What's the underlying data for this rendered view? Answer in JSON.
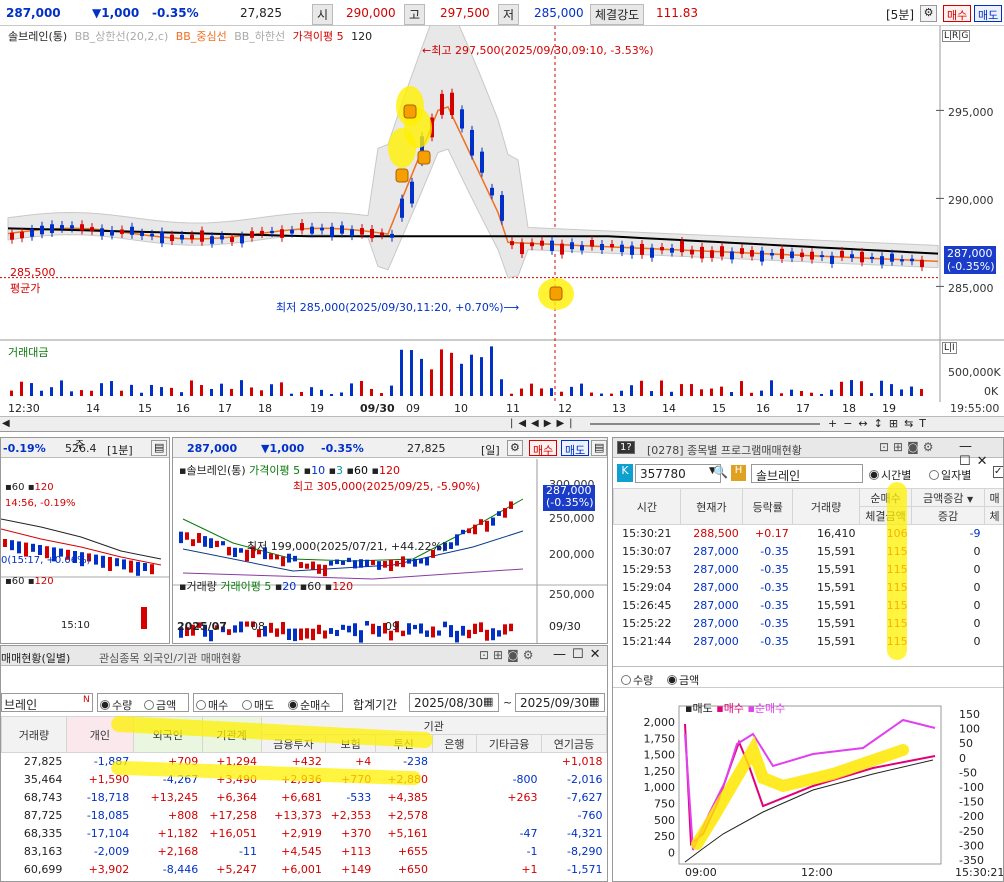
{
  "quote": {
    "price": "287,000",
    "change": "▼1,000",
    "change_pct": "-0.35%",
    "volume": "27,825",
    "open_label": "시",
    "open": "290,000",
    "high_label": "고",
    "high": "297,500",
    "low_label": "저",
    "low": "285,000",
    "strength_label": "체결강도",
    "strength": "111.83",
    "interval": "[5분]",
    "buy": "매수",
    "sell": "매도"
  },
  "main_chart": {
    "legend": [
      "솔브레인(통)",
      "BB_상한선(20,2,c)",
      "BB_중심선",
      "BB_하한선",
      "가격이평 5",
      "120"
    ],
    "max_note": "←최고 297,500(2025/09/30,09:10, -3.53%)",
    "min_note": "최저 285,000(2025/09/30,11:20, +0.70%)⟶",
    "price_tag": "287,000",
    "price_tag_pct": "(-0.35%)",
    "avg_label": "평균가",
    "avg_price": "285,500",
    "y_ticks": [
      "295,000",
      "290,000",
      "285,000"
    ],
    "vol_label": "거래대금",
    "vol_ticks": [
      "500,000K",
      "0K"
    ],
    "x_ticks": [
      "12:30",
      "14",
      "15",
      "16",
      "17",
      "18",
      "19",
      "09/30",
      "09",
      "10",
      "11",
      "12",
      "13",
      "14",
      "15",
      "16",
      "17",
      "18",
      "19"
    ],
    "time_readout": "19:55:00",
    "corner_tag": "L|R|G",
    "corner_tag2": "L|I"
  },
  "mini_left": {
    "pct": "-0.19%",
    "value": "526.4",
    "interval": "[1분]",
    "legend": [
      "60",
      "120"
    ],
    "note1": "14:56, -0.19%",
    "note2": "0(15:17, +0.06%)",
    "legend2": [
      "60",
      "120"
    ],
    "x_tick": "15:10",
    "tabs": [
      "주",
      "조기화"
    ]
  },
  "mini_mid": {
    "price": "287,000",
    "change": "▼1,000",
    "change_pct": "-0.35%",
    "volume": "27,825",
    "interval": "[일]",
    "buy": "매수",
    "sell": "매도",
    "legend": [
      "솔브레인(통)",
      "가격이평 5",
      "10",
      "3",
      "60",
      "120"
    ],
    "max_note": "최고 305,000(2025/09/25, -5.90%)",
    "min_note": "최저 199,000(2025/07/21, +44.22%)",
    "price_tag": "287,000",
    "price_tag_pct": "(-0.35%)",
    "y_ticks": [
      "300,000",
      "250,000",
      "200,000"
    ],
    "legend2": [
      "거래량",
      "거래이평 5",
      "20",
      "60",
      "120"
    ],
    "vol_tick": "250,000",
    "x_ticks": [
      "2025/07",
      "08",
      "09",
      "09/30"
    ]
  },
  "program": {
    "title": "[0278] 종목별 프로그램매매현황",
    "code": "357780",
    "name": "솔브레인",
    "mode_time": "시간별",
    "mode_day": "일자별",
    "headers": [
      "시간",
      "현재가",
      "등락률",
      "거래량",
      "순매수",
      "금액증감",
      "매"
    ],
    "sub_headers": [
      "체결금액",
      "증감",
      "체"
    ],
    "rows": [
      [
        "15:30:21",
        "288,500",
        "+0.17",
        "16,410",
        "106",
        "-9"
      ],
      [
        "15:30:07",
        "287,000",
        "-0.35",
        "15,591",
        "115",
        "0"
      ],
      [
        "15:29:53",
        "287,000",
        "-0.35",
        "15,591",
        "115",
        "0"
      ],
      [
        "15:29:04",
        "287,000",
        "-0.35",
        "15,591",
        "115",
        "0"
      ],
      [
        "15:26:45",
        "287,000",
        "-0.35",
        "15,591",
        "115",
        "0"
      ],
      [
        "15:25:22",
        "287,000",
        "-0.35",
        "15,591",
        "115",
        "0"
      ],
      [
        "15:21:44",
        "287,000",
        "-0.35",
        "15,591",
        "115",
        "0"
      ]
    ],
    "mode_qty": "수량",
    "mode_amt": "금액",
    "chart_legend": [
      "매도",
      "매수",
      "순매수"
    ],
    "left_ticks": [
      "2,000",
      "1,750",
      "1,500",
      "1,250",
      "1,000",
      "750",
      "500",
      "250",
      "0"
    ],
    "right_ticks": [
      "150",
      "100",
      "50",
      "0",
      "-50",
      "-100",
      "-150",
      "-200",
      "-250",
      "-300",
      "-350"
    ],
    "x_ticks": [
      "09:00",
      "12:00"
    ],
    "time_readout": "15:30:21"
  },
  "investor": {
    "title": "매매현황(일별)",
    "title2": "관심종목 외국인/기관 매매현황",
    "name": "브레인",
    "opts_a": [
      "수량",
      "금액"
    ],
    "opts_b": [
      "매수",
      "매도",
      "순매수"
    ],
    "period_label": "합계기간",
    "from": "2025/08/30",
    "to": "2025/09/30",
    "group_label": "기관",
    "headers": [
      "거래량",
      "개인",
      "외국인",
      "기관계",
      "금융투자",
      "보험",
      "투신",
      "은행",
      "기타금융",
      "연기금등"
    ],
    "rows": [
      [
        "27,825",
        "-1,887",
        "+709",
        "+1,294",
        "+432",
        "+4",
        "-238",
        "",
        "",
        "+1,018"
      ],
      [
        "35,464",
        "+1,590",
        "-4,267",
        "+3,490",
        "+2,936",
        "+770",
        "+2,880",
        "",
        "-800",
        "-2,016"
      ],
      [
        "68,743",
        "-18,718",
        "+13,245",
        "+6,364",
        "+6,681",
        "-533",
        "+4,385",
        "",
        "+263",
        "-7,627"
      ],
      [
        "87,725",
        "-18,085",
        "+808",
        "+17,258",
        "+13,373",
        "+2,353",
        "+2,578",
        "",
        "",
        "-760"
      ],
      [
        "68,335",
        "-17,104",
        "+1,182",
        "+16,051",
        "+2,919",
        "+370",
        "+5,161",
        "",
        "-47",
        "-4,321"
      ],
      [
        "83,163",
        "-2,009",
        "+2,168",
        "-11",
        "+4,545",
        "+113",
        "+655",
        "",
        "-1",
        "-8,290"
      ],
      [
        "60,699",
        "+3,902",
        "-8,446",
        "+5,247",
        "+6,001",
        "+149",
        "+650",
        "",
        "+1",
        "-1,571"
      ]
    ]
  },
  "colors": {
    "up": "#d40000",
    "down": "#0030c8",
    "highlight": "#fff000",
    "bb_mid": "#f07020",
    "ma120": "#000000"
  }
}
